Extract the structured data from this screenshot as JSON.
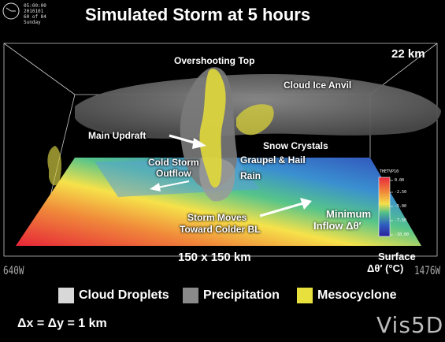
{
  "title": "Simulated Storm at 5 hours",
  "clock": {
    "time": "05:00:00",
    "date": "2010101",
    "step": "60 of 84",
    "day": "Sunday"
  },
  "height_label": "22 km",
  "labels": {
    "overshooting_top": "Overshooting Top",
    "cloud_ice_anvil": "Cloud Ice Anvil",
    "main_updraft": "Main Updraft",
    "snow_crystals": "Snow Crystals",
    "cold_storm_outflow_1": "Cold Storm",
    "cold_storm_outflow_2": "Outflow",
    "graupel_hail": "Graupel & Hail",
    "rain": "Rain",
    "storm_moves_1": "Storm Moves",
    "storm_moves_2": "Toward Colder BL",
    "minimum_inflow_1": "Minimum",
    "minimum_inflow_2": "Inflow Δθ′"
  },
  "domain_size": "150 x 150 km",
  "surface_label_1": "Surface",
  "surface_label_2": "Δθ′ (°C)",
  "corner_left": "640W",
  "corner_right": "1476W",
  "colorbar": {
    "name": "THETVP10",
    "ticks": [
      "0.00",
      "-2.50",
      "-5.00",
      "-7.50",
      "-10.00"
    ],
    "colors": [
      "#e8283c",
      "#f08a3a",
      "#f5e04a",
      "#4fc08a",
      "#2f5fc0",
      "#2a1f9a"
    ]
  },
  "legend": {
    "cloud_droplets": "Cloud Droplets",
    "precipitation": "Precipitation",
    "mesocyclone": "Mesocyclone",
    "colors": {
      "cloud_droplets": "#d8d8d8",
      "precipitation": "#8a8a8a",
      "mesocyclone": "#e8e03c"
    }
  },
  "resolution": "Δx = Δy = 1 km",
  "brand": "Vis5D"
}
